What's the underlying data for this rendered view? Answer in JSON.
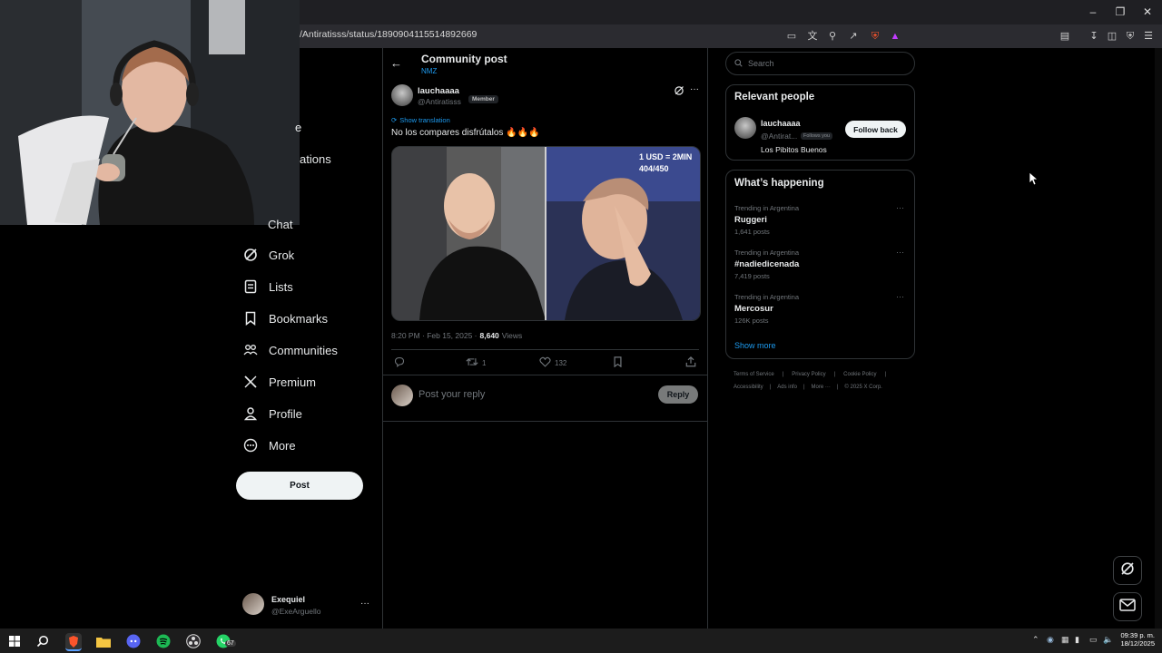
{
  "browser": {
    "url": "/Antiratisss/status/1890904115514892669",
    "window_controls": [
      "minimize",
      "restore",
      "close"
    ]
  },
  "nav": {
    "partial_items": [
      "e",
      "ations",
      "Chat"
    ],
    "items": [
      {
        "label": "Grok",
        "icon": "grok-icon"
      },
      {
        "label": "Lists",
        "icon": "lists-icon"
      },
      {
        "label": "Bookmarks",
        "icon": "bookmark-icon"
      },
      {
        "label": "Communities",
        "icon": "communities-icon"
      },
      {
        "label": "Premium",
        "icon": "x-logo-icon"
      },
      {
        "label": "Profile",
        "icon": "profile-icon"
      },
      {
        "label": "More",
        "icon": "more-circle-icon"
      }
    ],
    "post_label": "Post",
    "account": {
      "name": "Exequiel",
      "handle": "@ExeArguello"
    }
  },
  "main": {
    "header_title": "Community post",
    "header_sub": "NMZ",
    "tweet": {
      "author": "lauchaaaa",
      "handle": "@Antiratisss",
      "badge": "Member",
      "translation": "Show translation",
      "text": "No los compares disfrútalos 🔥🔥🔥",
      "image_caption_line1": "1 USD = 2MIN",
      "image_caption_line2": "404/450",
      "meta_time": "8:20 PM · Feb 15, 2025 ·",
      "views_count": "8,640",
      "views_label": "Views",
      "retweets": "1",
      "likes": "132"
    },
    "reply_placeholder": "Post your reply",
    "reply_label": "Reply"
  },
  "sidebar": {
    "search_placeholder": "Search",
    "relevant_title": "Relevant people",
    "person": {
      "name": "lauchaaaa",
      "handle": "@Antirat...",
      "follows_you": "Follows you",
      "bio": "Los Pibitos Buenos",
      "follow_label": "Follow back"
    },
    "happening_title": "What’s happening",
    "trends": [
      {
        "category": "Trending in Argentina",
        "name": "Ruggeri",
        "posts": "1,641 posts"
      },
      {
        "category": "Trending in Argentina",
        "name": "#nadiedicenada",
        "posts": "7,419 posts"
      },
      {
        "category": "Trending in Argentina",
        "name": "Mercosur",
        "posts": "126K posts"
      }
    ],
    "show_more": "Show more",
    "footer_row1": [
      "Terms of Service",
      "Privacy Policy",
      "Cookie Policy"
    ],
    "footer_row2": [
      "Accessibility",
      "Ads info",
      "More ···",
      "© 2025 X Corp."
    ]
  },
  "taskbar": {
    "time": "09:39 p. m.",
    "date": "18/12/2025",
    "whatsapp_badge": "67"
  },
  "colors": {
    "accent": "#1d9bf0",
    "background": "#000000",
    "muted": "#71767b",
    "border": "#2f3336"
  }
}
